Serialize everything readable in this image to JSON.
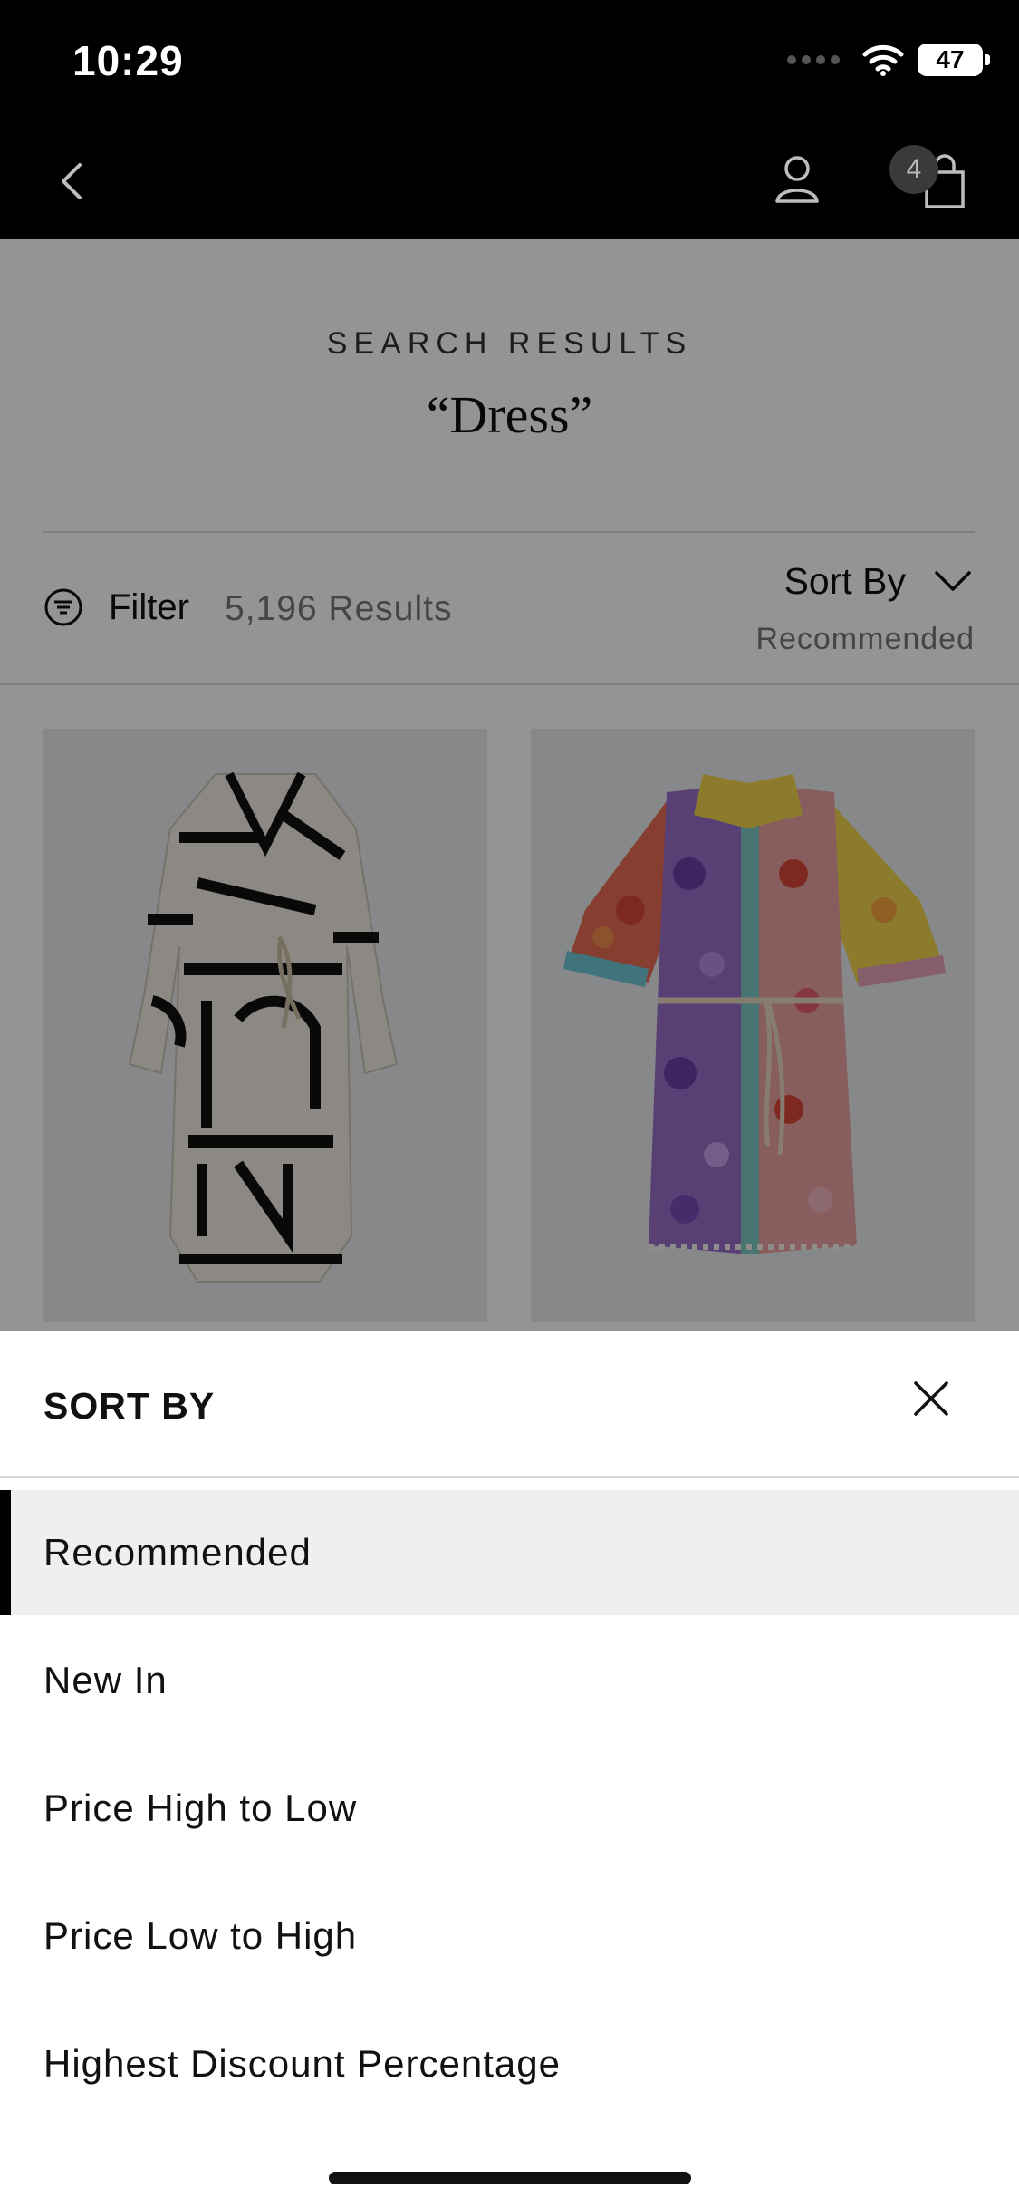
{
  "status_bar": {
    "time": "10:29",
    "battery": "47"
  },
  "nav": {
    "bag_count": "4"
  },
  "search": {
    "eyebrow": "SEARCH RESULTS",
    "query": "“Dress”"
  },
  "toolbar": {
    "filter_label": "Filter",
    "results_count": "5,196 Results",
    "sort_label": "Sort By",
    "sort_current": "Recommended"
  },
  "products": [
    {
      "description_icon": "dress-monogram-wrap",
      "colors": [
        "#f1ede4",
        "#111111"
      ]
    },
    {
      "description_icon": "dress-floral-shirt",
      "colors": [
        "#e66b54",
        "#9a6fc9",
        "#f2d44e",
        "#6fc7d6"
      ]
    }
  ],
  "sheet": {
    "title": "SORT BY",
    "options": [
      {
        "label": "Recommended",
        "selected": true
      },
      {
        "label": "New In",
        "selected": false
      },
      {
        "label": "Price High to Low",
        "selected": false
      },
      {
        "label": "Price Low to High",
        "selected": false
      },
      {
        "label": "Highest Discount Percentage",
        "selected": false
      }
    ]
  }
}
